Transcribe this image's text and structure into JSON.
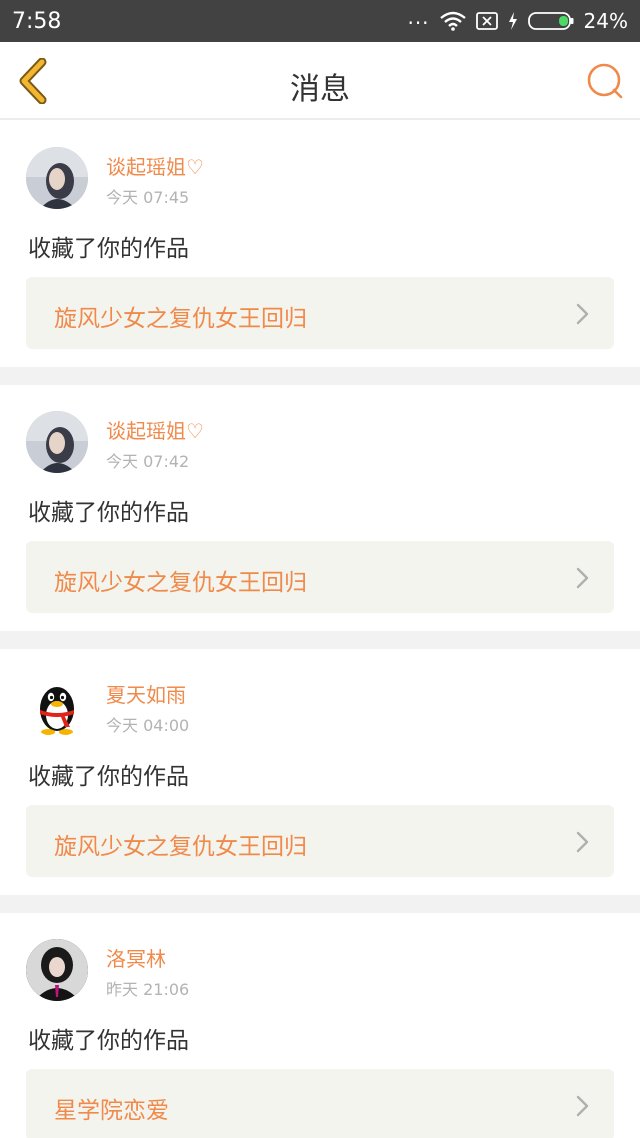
{
  "status_bar": {
    "time": "7:58",
    "dots": "...",
    "battery_percent": "24%",
    "battery_level": 0.24,
    "icons": [
      "signal-dots-icon",
      "wifi-icon",
      "no-sim-icon",
      "charging-icon",
      "battery-icon"
    ]
  },
  "nav": {
    "title": "消息",
    "back_icon": "chevron-left-icon",
    "search_icon": "search-icon"
  },
  "colors": {
    "accent": "#f08a4b",
    "back_icon": "#f2b632",
    "status_bar": "#424242",
    "work_box_bg": "#f4f4ee",
    "separator": "#f2f2f2"
  },
  "messages": [
    {
      "username": "谈起瑶姐♡",
      "time": "今天 07:45",
      "action": "收藏了你的作品",
      "work_title": "旋风少女之复仇女王回归",
      "avatar": "girl-photo-avatar"
    },
    {
      "username": "谈起瑶姐♡",
      "time": "今天 07:42",
      "action": "收藏了你的作品",
      "work_title": "旋风少女之复仇女王回归",
      "avatar": "girl-photo-avatar"
    },
    {
      "username": "夏天如雨",
      "time": "今天 04:00",
      "action": "收藏了你的作品",
      "work_title": "旋风少女之复仇女王回归",
      "avatar": "penguin-avatar"
    },
    {
      "username": "洛冥林",
      "time": "昨天 21:06",
      "action": "收藏了你的作品",
      "work_title": "星学院恋爱",
      "avatar": "dark-photo-avatar"
    }
  ]
}
